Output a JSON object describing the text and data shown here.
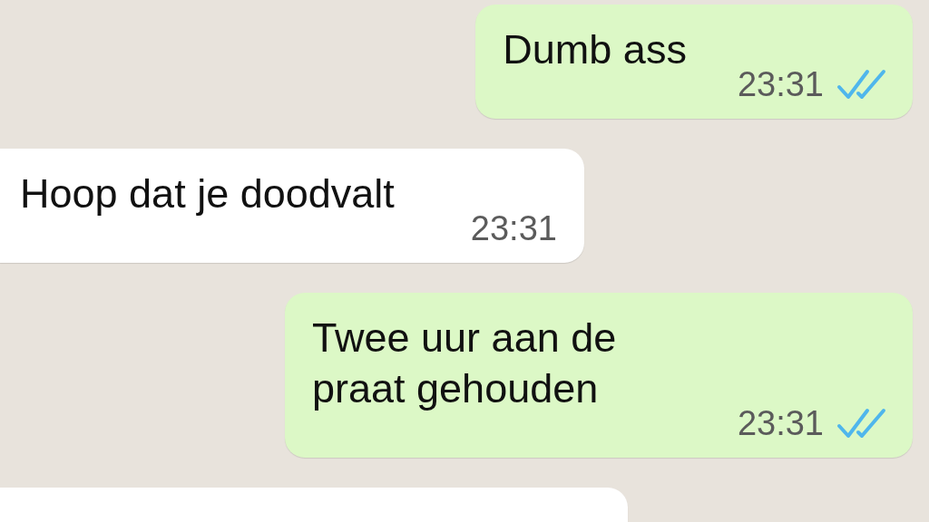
{
  "messages": [
    {
      "kind": "outgoing",
      "text": "Dumb ass",
      "time": "23:31",
      "read": true
    },
    {
      "kind": "incoming",
      "text": "Hoop dat je doodvalt",
      "time": "23:31"
    },
    {
      "kind": "outgoing",
      "text": "Twee uur aan de praat gehouden",
      "time": "23:31",
      "read": true
    },
    {
      "kind": "incoming"
    }
  ]
}
